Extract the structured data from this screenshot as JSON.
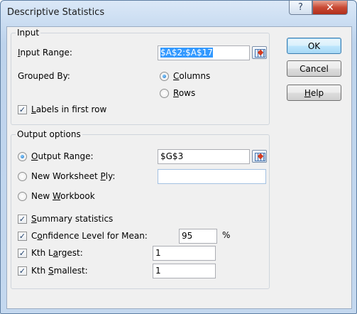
{
  "window": {
    "title": "Descriptive Statistics",
    "help_glyph": "?",
    "close_glyph": "✕"
  },
  "input_group": {
    "title": "Input",
    "input_range_label_pre": "",
    "input_range_label_u": "I",
    "input_range_label_post": "nput Range:",
    "input_range_value": "$A$2:$A$17",
    "grouped_by_label": "Grouped By:",
    "columns_u": "C",
    "columns_rest": "olumns",
    "rows_u": "R",
    "rows_rest": "ows",
    "labels_u": "L",
    "labels_rest": "abels in first row",
    "labels_checked": true,
    "grouped_by_selected": "Columns"
  },
  "output_group": {
    "title": "Output options",
    "output_range_u": "O",
    "output_range_rest": "utput Range:",
    "output_range_value": "$G$3",
    "new_ply_pre": "New Worksheet ",
    "new_ply_u": "P",
    "new_ply_post": "ly:",
    "new_ply_value": "",
    "new_workbook_pre": "New ",
    "new_workbook_u": "W",
    "new_workbook_post": "orkbook",
    "output_selected": "Output Range",
    "summary_u": "S",
    "summary_rest": "ummary statistics",
    "summary_checked": true,
    "confidence_pre": "C",
    "confidence_u": "o",
    "confidence_post": "nfidence Level for Mean:",
    "confidence_checked": true,
    "confidence_value": "95",
    "percent": "%",
    "kth_largest_pre": "Kth L",
    "kth_largest_u": "a",
    "kth_largest_post": "rgest:",
    "kth_largest_checked": true,
    "kth_largest_value": "1",
    "kth_smallest_pre": "Kth ",
    "kth_smallest_u": "S",
    "kth_smallest_post": "mallest:",
    "kth_smallest_checked": true,
    "kth_smallest_value": "1"
  },
  "buttons": {
    "ok": "OK",
    "cancel": "Cancel",
    "help_u": "H",
    "help_rest": "elp"
  },
  "check_glyph": "✓"
}
